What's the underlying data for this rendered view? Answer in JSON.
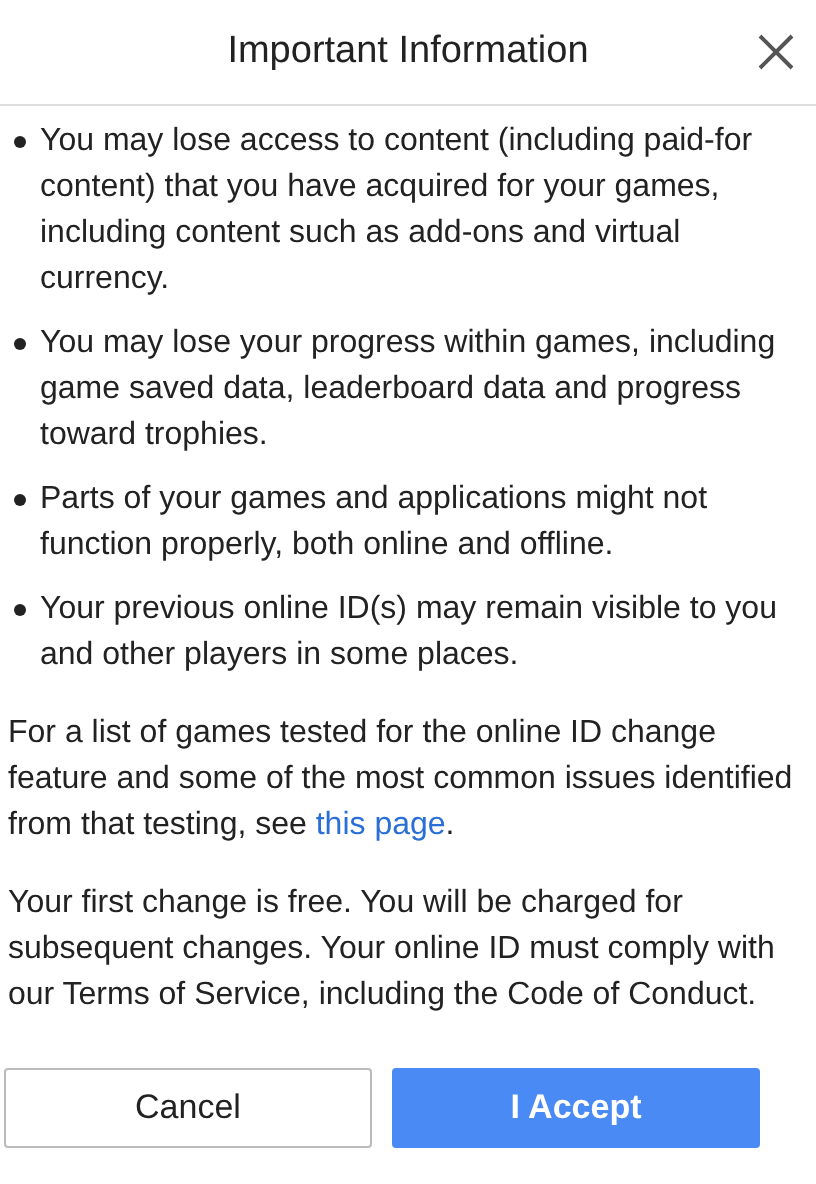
{
  "dialog": {
    "title": "Important Information"
  },
  "bullets": [
    "You may lose access to content (including paid-for content) that you have acquired for your games, including content such as add-ons and virtual currency.",
    "You may lose your progress within games, including game saved data, leaderboard data and progress toward trophies.",
    "Parts of your games and applications might not function properly, both online and offline.",
    "Your previous online ID(s) may remain visible to you and other players in some places."
  ],
  "paragraphs": [
    {
      "text": "For a list of games tested for the online ID change feature and some of the most common issues identified from that testing, see ",
      "link": "this page",
      "after": "."
    },
    {
      "text": "Your first change is free. You will be charged for subsequent changes. Your online ID must comply with our Terms of Service, including the Code of Conduct."
    }
  ],
  "buttons": [
    {
      "label": "Cancel",
      "kind": "secondary"
    },
    {
      "label": "I Accept",
      "kind": "primary"
    }
  ]
}
